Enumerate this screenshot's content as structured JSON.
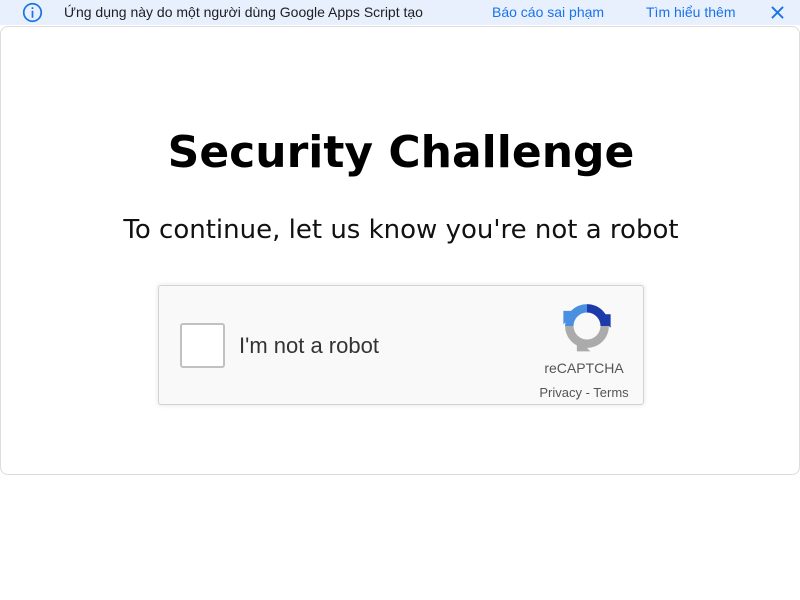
{
  "banner": {
    "icon": "info-icon",
    "text": "Ứng dụng này do một người dùng Google Apps Script tạo",
    "report_label": "Báo cáo sai phạm",
    "learn_more_label": "Tìm hiểu thêm",
    "close_icon": "close-icon",
    "background_color": "#e8f0fe",
    "link_color": "#1a73e8"
  },
  "page": {
    "title": "Security Challenge",
    "subtitle": "To continue, let us know you're not a robot"
  },
  "recaptcha": {
    "checkbox_label": "I'm not a robot",
    "checked": false,
    "brand": "reCAPTCHA",
    "privacy_label": "Privacy",
    "separator": " - ",
    "terms_label": "Terms",
    "logo_icon": "recaptcha-logo-icon"
  }
}
